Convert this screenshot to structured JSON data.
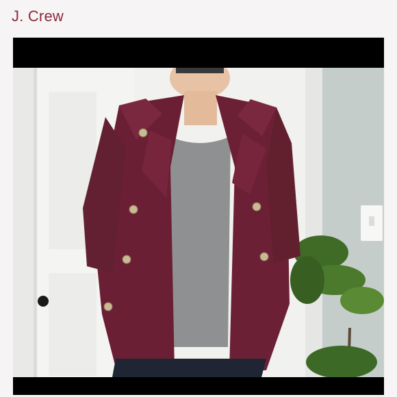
{
  "listing": {
    "brand": "J. Crew"
  },
  "image": {
    "subject": "burgundy-peacoat-photo",
    "colors": {
      "coat": "#6b1f35",
      "shirt": "#8f9092",
      "door": "#f2f2f0",
      "wall": "#cfd6d2"
    }
  }
}
